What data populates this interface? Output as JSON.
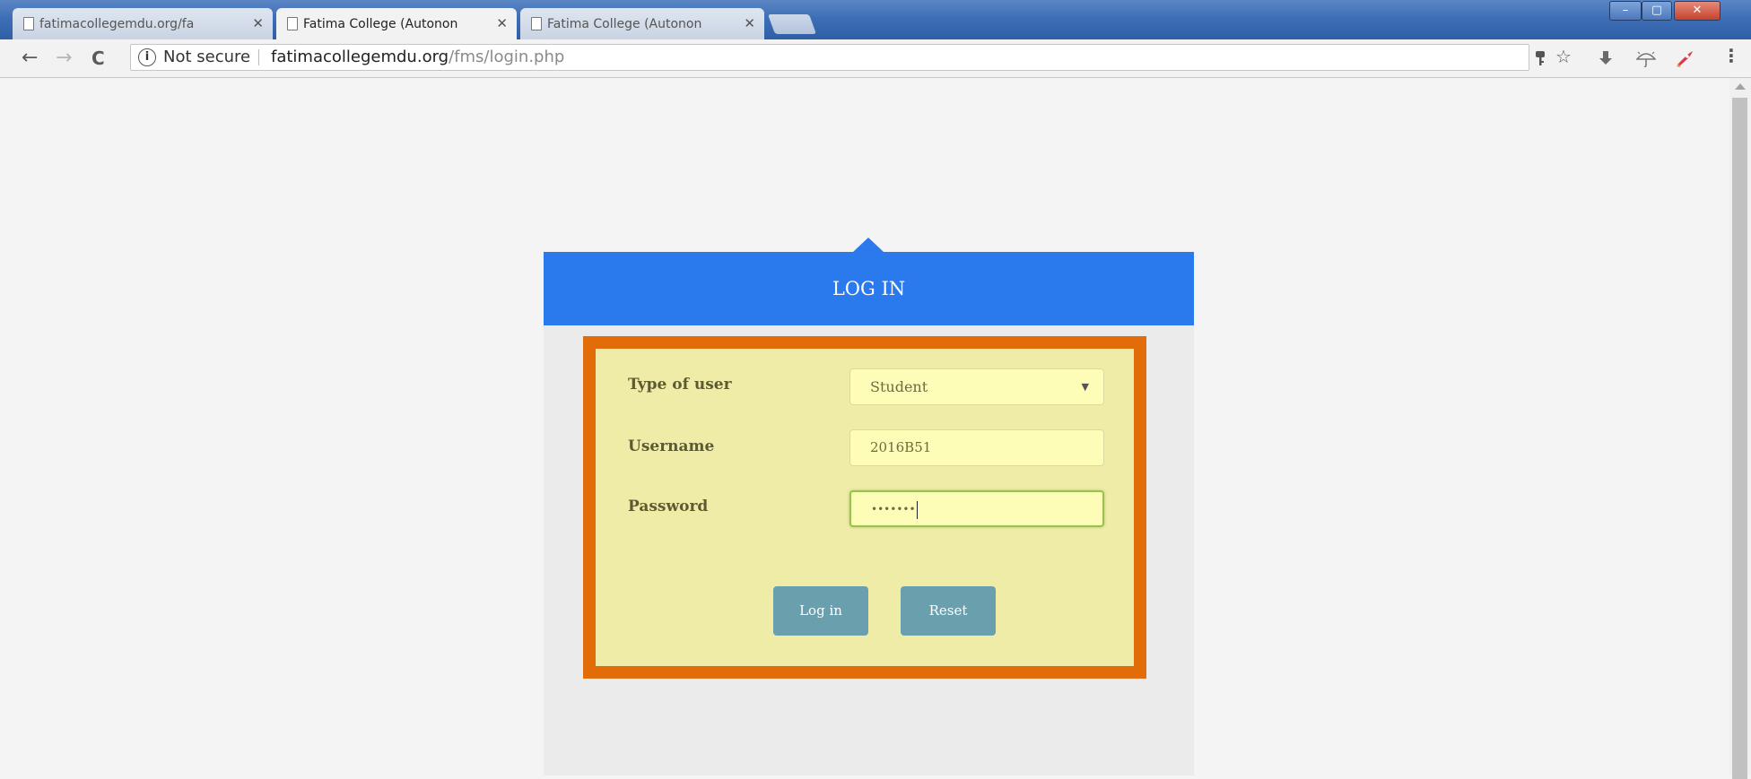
{
  "browser": {
    "tabs": [
      {
        "label": "fatimacollegemdu.org/fa",
        "close": "✕"
      },
      {
        "label": "Fatima College (Autonon",
        "close": "✕"
      },
      {
        "label": "Fatima College (Autonon",
        "close": "✕"
      }
    ],
    "window_controls": {
      "minimize": "–",
      "maximize": "▢",
      "close": "✕"
    },
    "address": {
      "security_label": "Not secure",
      "info_glyph": "i",
      "host": "fatimacollegemdu.org",
      "path": "/fms/login.php"
    },
    "nav": {
      "back": "←",
      "forward": "→",
      "reload": "C"
    },
    "toolbar_icons": [
      "key-icon",
      "star-icon",
      "download-icon",
      "umbrella-icon",
      "rocket-icon",
      "menu-icon"
    ]
  },
  "login": {
    "title": "LOG IN",
    "fields": {
      "user_type_label": "Type of user",
      "user_type_value": "Student",
      "username_label": "Username",
      "username_value": "2016B51",
      "password_label": "Password",
      "password_value": "•••••••"
    },
    "buttons": {
      "login": "Log in",
      "reset": "Reset"
    }
  },
  "colors": {
    "header_blue": "#2a7aee",
    "highlight_border": "#e36c0a",
    "form_bg": "#efeca7",
    "button": "#6a9fae"
  }
}
